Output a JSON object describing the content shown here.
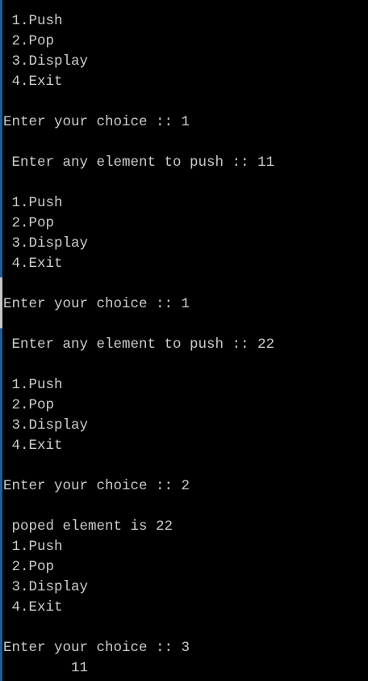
{
  "console": {
    "lines": [
      " 1.Push",
      " 2.Pop",
      " 3.Display",
      " 4.Exit",
      "",
      "Enter your choice :: 1",
      "",
      " Enter any element to push :: 11",
      "",
      " 1.Push",
      " 2.Pop",
      " 3.Display",
      " 4.Exit",
      "",
      "Enter your choice :: 1",
      "",
      " Enter any element to push :: 22",
      "",
      " 1.Push",
      " 2.Pop",
      " 3.Display",
      " 4.Exit",
      "",
      "Enter your choice :: 2",
      "",
      " poped element is 22",
      " 1.Push",
      " 2.Pop",
      " 3.Display",
      " 4.Exit",
      "",
      "Enter your choice :: 3",
      "\t11"
    ]
  },
  "colors": {
    "text": "#cccccc",
    "background": "#000000",
    "edge": "#1f5d9e"
  }
}
